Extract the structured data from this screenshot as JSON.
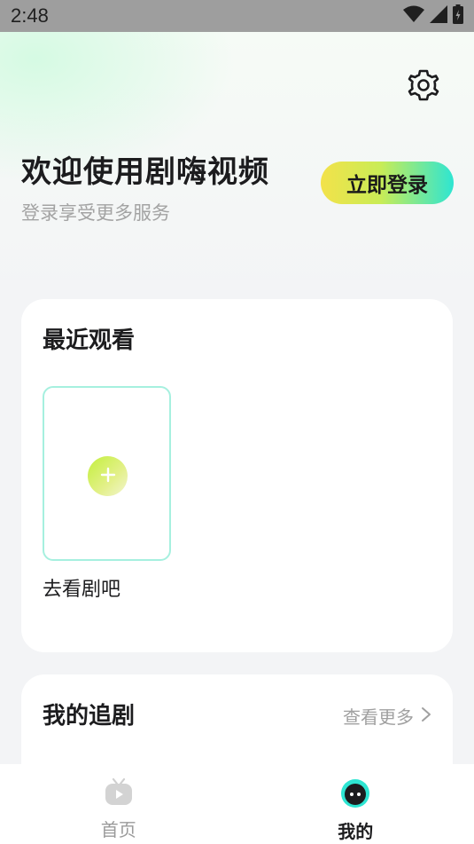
{
  "status_bar": {
    "time": "2:48",
    "icons": [
      "wifi-icon",
      "signal-icon",
      "battery-icon"
    ]
  },
  "header": {
    "settings_icon": "gear-icon",
    "welcome_title": "欢迎使用剧嗨视频",
    "welcome_subtitle": "登录享受更多服务",
    "login_label": "立即登录"
  },
  "recent": {
    "title": "最近观看",
    "add_label": "去看剧吧",
    "add_icon": "plus-icon"
  },
  "follow": {
    "title": "我的追剧",
    "more_label": "查看更多"
  },
  "tab_bar": {
    "tabs": [
      {
        "label": "首页",
        "icon": "tv-icon",
        "active": false
      },
      {
        "label": "我的",
        "icon": "robot-face-icon",
        "active": true
      }
    ]
  },
  "colors": {
    "accent_yellow": "#f3e24a",
    "accent_cyan": "#2ee5d2",
    "tile_border": "#a6f0df",
    "background": "#f3f4f6"
  }
}
